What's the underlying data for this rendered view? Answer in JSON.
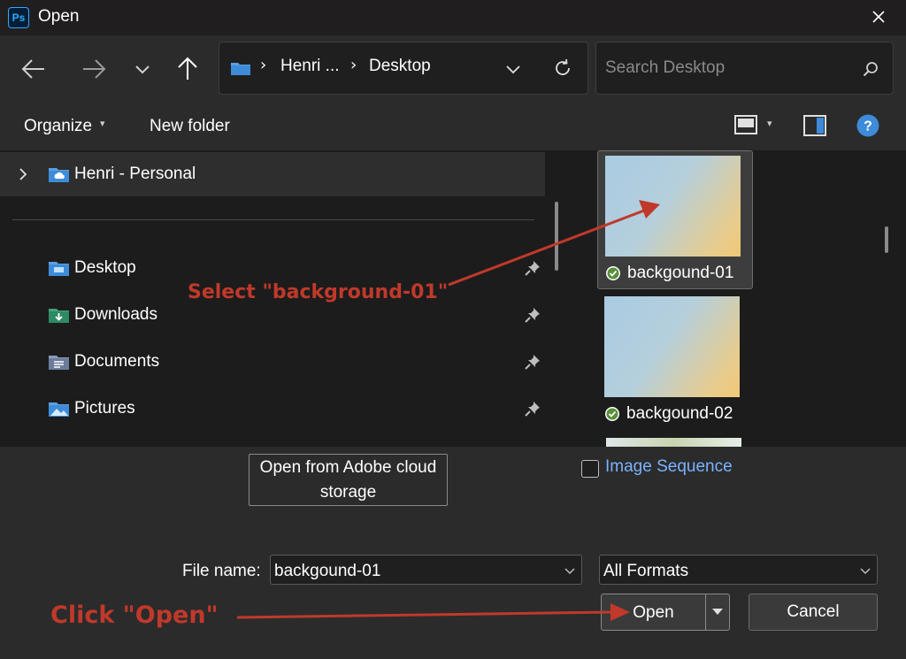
{
  "window": {
    "title": "Open",
    "app_badge": "Ps"
  },
  "address_bar": {
    "crumbs": [
      "Henri ...",
      "Desktop"
    ]
  },
  "search": {
    "placeholder": "Search Desktop"
  },
  "toolbar": {
    "organize": "Organize",
    "new_folder": "New folder"
  },
  "sidebar": {
    "root": {
      "label": "Henri - Personal"
    },
    "items": [
      {
        "label": "Desktop",
        "icon": "desktop-folder-icon"
      },
      {
        "label": "Downloads",
        "icon": "downloads-folder-icon"
      },
      {
        "label": "Documents",
        "icon": "documents-folder-icon"
      },
      {
        "label": "Pictures",
        "icon": "pictures-folder-icon"
      }
    ]
  },
  "files": [
    {
      "name": "backgound-01",
      "selected": true
    },
    {
      "name": "backgound-02",
      "selected": false
    }
  ],
  "bottom": {
    "cloud_button_line1": "Open from Adobe cloud",
    "cloud_button_line2": "storage",
    "image_sequence": "Image Sequence",
    "file_name_label": "File name:",
    "file_name_value": "backgound-01",
    "format_value": "All Formats",
    "open_button": "Open",
    "cancel_button": "Cancel"
  },
  "annotations": {
    "select_note": "Select \"background-01\"",
    "click_note": "Click \"Open\""
  },
  "colors": {
    "annotation": "#c0392b",
    "link": "#7ab2ff",
    "photoshop": "#31a8ff"
  }
}
